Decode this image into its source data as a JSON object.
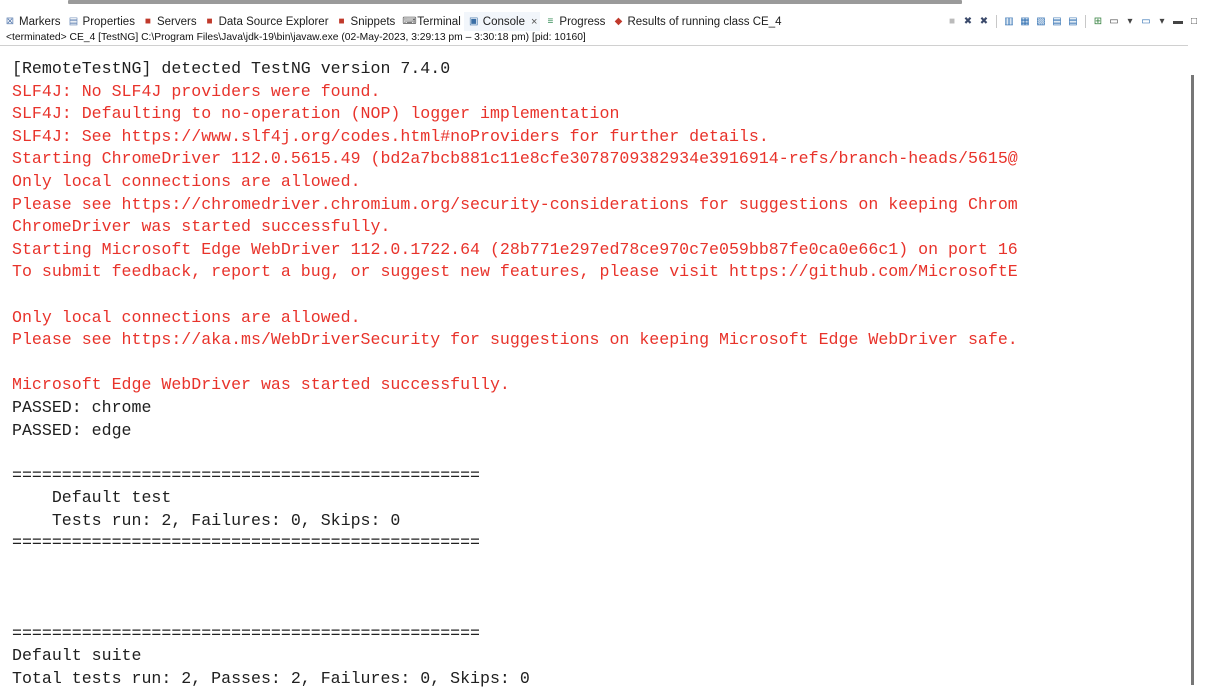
{
  "tabs": [
    {
      "label": "Markers",
      "icon": "markers-icon",
      "glyph": "⊠"
    },
    {
      "label": "Properties",
      "icon": "properties-icon",
      "glyph": "▤"
    },
    {
      "label": "Servers",
      "icon": "servers-icon",
      "glyph": "■"
    },
    {
      "label": "Data Source Explorer",
      "icon": "data-source-icon",
      "glyph": "■"
    },
    {
      "label": "Snippets",
      "icon": "snippets-icon",
      "glyph": "■"
    },
    {
      "label": "Terminal",
      "icon": "terminal-icon",
      "glyph": "⌨"
    },
    {
      "label": "Console",
      "icon": "console-icon",
      "glyph": "▣",
      "active": true,
      "close": "×"
    },
    {
      "label": "Progress",
      "icon": "progress-icon",
      "glyph": "≡"
    },
    {
      "label": "Results of running class CE_4",
      "icon": "testng-results-icon",
      "glyph": "◆"
    }
  ],
  "status": "<terminated> CE_4 [TestNG] C:\\Program Files\\Java\\jdk-19\\bin\\javaw.exe  (02-May-2023, 3:29:13 pm – 3:30:18 pm) [pid: 10160]",
  "console_lines": [
    {
      "text": "[RemoteTestNG] detected TestNG version 7.4.0",
      "type": "out"
    },
    {
      "text": "SLF4J: No SLF4J providers were found.",
      "type": "err"
    },
    {
      "text": "SLF4J: Defaulting to no-operation (NOP) logger implementation",
      "type": "err"
    },
    {
      "text": "SLF4J: See https://www.slf4j.org/codes.html#noProviders for further details.",
      "type": "err"
    },
    {
      "text": "Starting ChromeDriver 112.0.5615.49 (bd2a7bcb881c11e8cfe3078709382934e3916914-refs/branch-heads/5615@",
      "type": "err"
    },
    {
      "text": "Only local connections are allowed.",
      "type": "err"
    },
    {
      "text": "Please see https://chromedriver.chromium.org/security-considerations for suggestions on keeping Chrom",
      "type": "err"
    },
    {
      "text": "ChromeDriver was started successfully.",
      "type": "err"
    },
    {
      "text": "Starting Microsoft Edge WebDriver 112.0.1722.64 (28b771e297ed78ce970c7e059bb87fe0ca0e66c1) on port 16",
      "type": "err"
    },
    {
      "text": "To submit feedback, report a bug, or suggest new features, please visit https://github.com/MicrosoftE",
      "type": "err"
    },
    {
      "text": "",
      "type": "err"
    },
    {
      "text": "Only local connections are allowed.",
      "type": "err"
    },
    {
      "text": "Please see https://aka.ms/WebDriverSecurity for suggestions on keeping Microsoft Edge WebDriver safe.",
      "type": "err"
    },
    {
      "text": "",
      "type": "err"
    },
    {
      "text": "Microsoft Edge WebDriver was started successfully.",
      "type": "err"
    },
    {
      "text": "PASSED: chrome",
      "type": "out"
    },
    {
      "text": "PASSED: edge",
      "type": "out"
    },
    {
      "text": "",
      "type": "out"
    },
    {
      "text": "===============================================",
      "type": "out"
    },
    {
      "text": "    Default test",
      "type": "out"
    },
    {
      "text": "    Tests run: 2, Failures: 0, Skips: 0",
      "type": "out"
    },
    {
      "text": "===============================================",
      "type": "out"
    },
    {
      "text": "",
      "type": "out"
    },
    {
      "text": "",
      "type": "out"
    },
    {
      "text": "",
      "type": "out"
    },
    {
      "text": "===============================================",
      "type": "out"
    },
    {
      "text": "Default suite",
      "type": "out"
    },
    {
      "text": "Total tests run: 2, Passes: 2, Failures: 0, Skips: 0",
      "type": "out"
    },
    {
      "text": "===============================================",
      "type": "out"
    }
  ],
  "toolbar_icons": [
    {
      "name": "terminate-icon",
      "glyph": "■"
    },
    {
      "name": "remove-launch-icon",
      "glyph": "✖"
    },
    {
      "name": "remove-all-terminated-icon",
      "glyph": "✖"
    },
    {
      "name": "sep"
    },
    {
      "name": "show-on-stdout-icon",
      "glyph": "▥"
    },
    {
      "name": "pin-console-icon",
      "glyph": "▦"
    },
    {
      "name": "scroll-lock-icon",
      "glyph": "▧"
    },
    {
      "name": "word-wrap-icon",
      "glyph": "▤"
    },
    {
      "name": "clear-console-icon",
      "glyph": "▤"
    },
    {
      "name": "sep"
    },
    {
      "name": "open-console-icon",
      "glyph": "⊞"
    },
    {
      "name": "display-selected-console-icon",
      "glyph": "▭"
    },
    {
      "name": "dropdown-icon",
      "glyph": "▾"
    },
    {
      "name": "new-console-icon",
      "glyph": "▭"
    },
    {
      "name": "dropdown-icon-2",
      "glyph": "▾"
    },
    {
      "name": "minimize-icon",
      "glyph": "▬"
    },
    {
      "name": "maximize-icon",
      "glyph": "□"
    }
  ]
}
